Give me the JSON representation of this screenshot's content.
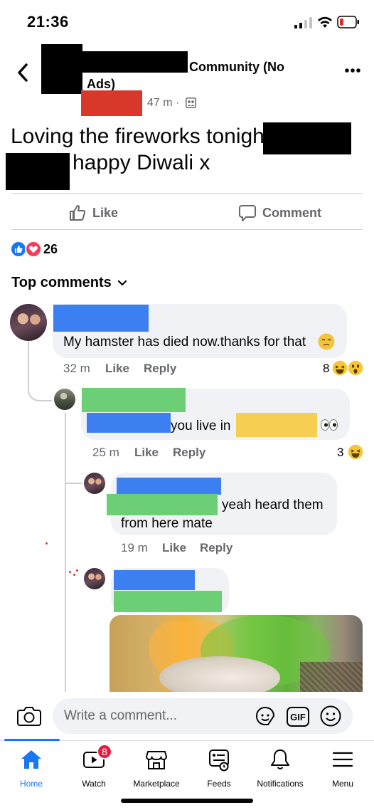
{
  "status_bar": {
    "time": "21:36"
  },
  "header": {
    "group_name_line1": "Community (No",
    "group_name_line2": "Ads)",
    "post_time": "47 m ·"
  },
  "post": {
    "text_line1": "Loving the fireworks tonight",
    "text_line2": "happy Diwali x"
  },
  "actions": {
    "like_label": "Like",
    "comment_label": "Comment"
  },
  "reactions": {
    "count": "26"
  },
  "comments_header": "Top comments",
  "comments": [
    {
      "text": "My hamster has died now.thanks for that",
      "time": "32 m",
      "like": "Like",
      "reply": "Reply",
      "reaction_count": "8"
    },
    {
      "text": "you live in",
      "time": "25 m",
      "like": "Like",
      "reply": "Reply",
      "reaction_count": "3"
    },
    {
      "text_line1": "yeah heard them",
      "text_line2": "from here mate",
      "time": "19 m",
      "like": "Like",
      "reply": "Reply"
    }
  ],
  "composer": {
    "placeholder": "Write a comment...",
    "gif_label": "GIF"
  },
  "tabs": [
    {
      "label": "Home",
      "icon": "home-icon"
    },
    {
      "label": "Watch",
      "icon": "watch-icon",
      "badge": "8"
    },
    {
      "label": "Marketplace",
      "icon": "marketplace-icon"
    },
    {
      "label": "Feeds",
      "icon": "feeds-icon"
    },
    {
      "label": "Notifications",
      "icon": "bell-icon"
    },
    {
      "label": "Menu",
      "icon": "menu-icon"
    }
  ],
  "colors": {
    "accent": "#1877f2",
    "redaction_black": "#000000",
    "redaction_blue": "#3b7ff0",
    "redaction_green": "#6ccf76",
    "redaction_red": "#d7382a",
    "redaction_yellow": "#f6cf52"
  }
}
